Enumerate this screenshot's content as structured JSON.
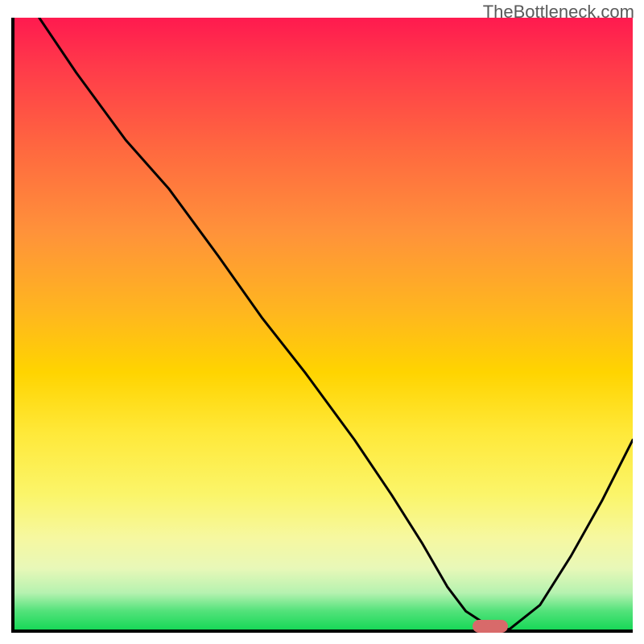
{
  "watermark": "TheBottleneck.com",
  "chart_data": {
    "type": "line",
    "title": "",
    "xlabel": "",
    "ylabel": "",
    "xlim": [
      0,
      100
    ],
    "ylim": [
      0,
      100
    ],
    "background": "heat-gradient",
    "gradient_stops": [
      {
        "pos": 0,
        "color": "#ff1a4f"
      },
      {
        "pos": 22,
        "color": "#ff6a3f"
      },
      {
        "pos": 48,
        "color": "#ffb61f"
      },
      {
        "pos": 68,
        "color": "#ffe93a"
      },
      {
        "pos": 90,
        "color": "#e8f8b8"
      },
      {
        "pos": 100,
        "color": "#18d858"
      }
    ],
    "series": [
      {
        "name": "bottleneck-curve",
        "x": [
          4,
          10,
          18,
          25,
          33,
          40,
          47,
          55,
          61,
          66,
          70,
          73,
          76,
          80,
          85,
          90,
          95,
          100
        ],
        "y": [
          100,
          91,
          80,
          72,
          61,
          51,
          42,
          31,
          22,
          14,
          7,
          3,
          1,
          0,
          4,
          12,
          21,
          31
        ]
      }
    ],
    "marker": {
      "name": "optimal-point",
      "x": 77,
      "y": 0,
      "color": "#d86a6a"
    }
  }
}
